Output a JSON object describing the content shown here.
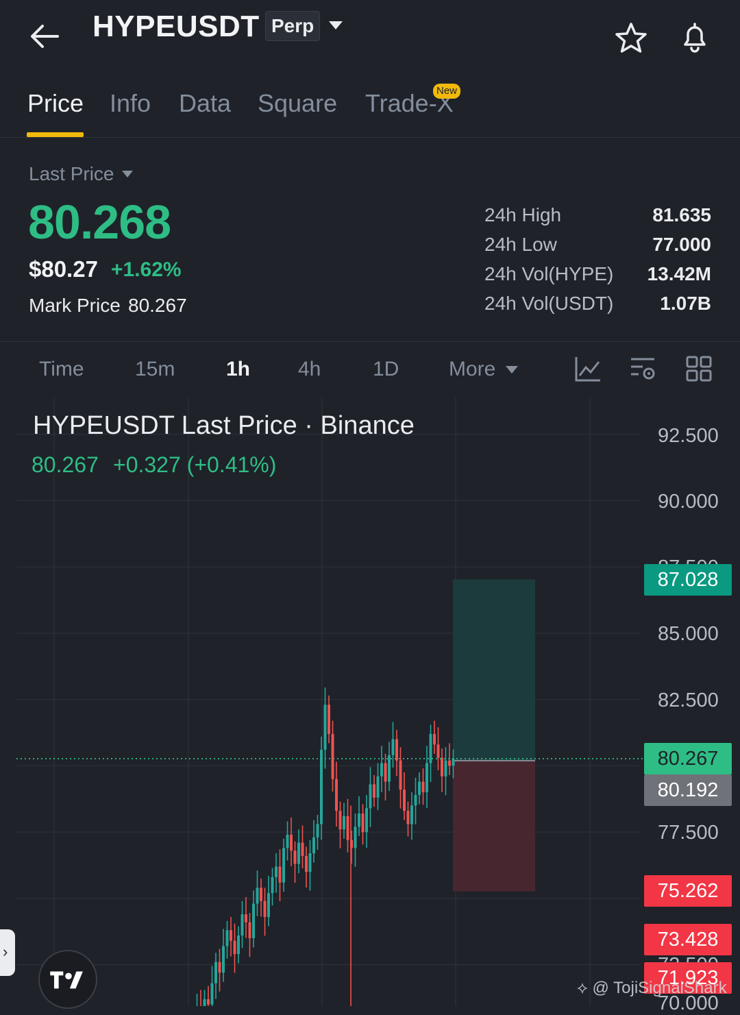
{
  "header": {
    "symbol": "HYPEUSDT",
    "contract_badge": "Perp"
  },
  "tabs": [
    {
      "label": "Price",
      "active": true
    },
    {
      "label": "Info",
      "active": false
    },
    {
      "label": "Data",
      "active": false
    },
    {
      "label": "Square",
      "active": false
    },
    {
      "label": "Trade-X",
      "active": false,
      "badge": "New"
    }
  ],
  "price": {
    "label": "Last Price",
    "last": "80.268",
    "usd": "$80.27",
    "change_pct": "+1.62%",
    "mark_label": "Mark Price",
    "mark_value": "80.267"
  },
  "stats": [
    {
      "label": "24h High",
      "value": "81.635"
    },
    {
      "label": "24h Low",
      "value": "77.000"
    },
    {
      "label": "24h Vol(HYPE)",
      "value": "13.42M"
    },
    {
      "label": "24h Vol(USDT)",
      "value": "1.07B"
    }
  ],
  "intervals": [
    {
      "label": "Time",
      "active": false
    },
    {
      "label": "15m",
      "active": false
    },
    {
      "label": "1h",
      "active": true
    },
    {
      "label": "4h",
      "active": false
    },
    {
      "label": "1D",
      "active": false
    },
    {
      "label": "More",
      "active": false
    }
  ],
  "toolbar_icons": [
    "indicator-chart-icon",
    "chart-settings-icon",
    "layout-grid-icon"
  ],
  "chart": {
    "title": "HYPEUSDT Last Price · Binance",
    "sub_price": "80.267",
    "sub_change": "+0.327 (+0.41%)",
    "axis_labels": [
      "92.500",
      "90.000",
      "87.500",
      "85.000",
      "82.500",
      "77.500",
      "72.500",
      "70.000"
    ],
    "price_tags": [
      {
        "value": "87.028",
        "color": "#0a9981"
      },
      {
        "value": "80.267",
        "color": "#2ebd85"
      },
      {
        "value": "80.192",
        "color": "#6f7379"
      },
      {
        "value": "75.262",
        "color": "#f23645"
      },
      {
        "value": "73.428",
        "color": "#f23645"
      },
      {
        "value": "71.923",
        "color": "#f23645"
      }
    ],
    "colors": {
      "up": "#26a69a",
      "down": "#ef5350",
      "target_zone": "#1c3d3d",
      "stop_zone": "#4a272f"
    }
  },
  "chart_data": {
    "type": "candlestick",
    "title": "HYPEUSDT Last Price · Binance",
    "y_range": [
      70.0,
      93.0
    ],
    "y_ticks": [
      92.5,
      90.0,
      87.5,
      85.0,
      82.5,
      80.0,
      77.5,
      75.0,
      72.5,
      70.0
    ],
    "current_price": 80.267,
    "position": {
      "entry": 80.192,
      "target": 87.028,
      "stop": 75.262
    },
    "key_levels": [
      87.028,
      80.267,
      80.192,
      75.262,
      73.428,
      71.923
    ],
    "candles_close": [
      70.4,
      70.9,
      70.6,
      71.2,
      71.0,
      71.8,
      72.6,
      72.2,
      73.2,
      73.8,
      73.4,
      72.9,
      73.6,
      74.4,
      74.1,
      73.5,
      74.8,
      75.4,
      74.9,
      74.3,
      75.2,
      75.8,
      76.2,
      75.6,
      76.9,
      77.4,
      76.8,
      76.3,
      77.1,
      76.6,
      76.0,
      76.7,
      77.3,
      77.8,
      80.6,
      82.3,
      81.2,
      79.5,
      78.3,
      77.6,
      78.1,
      77.2,
      76.9,
      77.7,
      78.2,
      77.5,
      78.4,
      79.3,
      78.8,
      79.6,
      80.1,
      79.4,
      80.4,
      81.0,
      80.2,
      79.1,
      78.3,
      77.8,
      78.5,
      78.9,
      79.4,
      79.0,
      80.1,
      81.2,
      80.8,
      80.3,
      79.6,
      80.2,
      80.0,
      80.267
    ]
  }
}
